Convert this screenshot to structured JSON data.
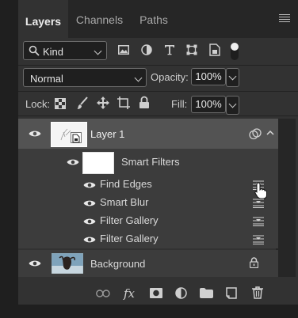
{
  "tabs": {
    "layers": "Layers",
    "channels": "Channels",
    "paths": "Paths"
  },
  "filter": {
    "kind_label": "Kind"
  },
  "blend": {
    "mode": "Normal",
    "opacity_label": "Opacity:",
    "opacity_value": "100%"
  },
  "lock": {
    "label": "Lock:",
    "fill_label": "Fill:",
    "fill_value": "100%"
  },
  "layers": {
    "layer1": {
      "name": "Layer 1"
    },
    "smart_filters": {
      "name": "Smart Filters"
    },
    "filters": [
      {
        "name": "Find Edges"
      },
      {
        "name": "Smart Blur"
      },
      {
        "name": "Filter Gallery"
      },
      {
        "name": "Filter Gallery"
      }
    ],
    "background": {
      "name": "Background"
    }
  },
  "bottom": {
    "fx_label": "fx"
  },
  "colors": {
    "panel": "#323232",
    "tabbar": "#262626",
    "selected_row": "#535353",
    "field": "#1f1f1f"
  }
}
